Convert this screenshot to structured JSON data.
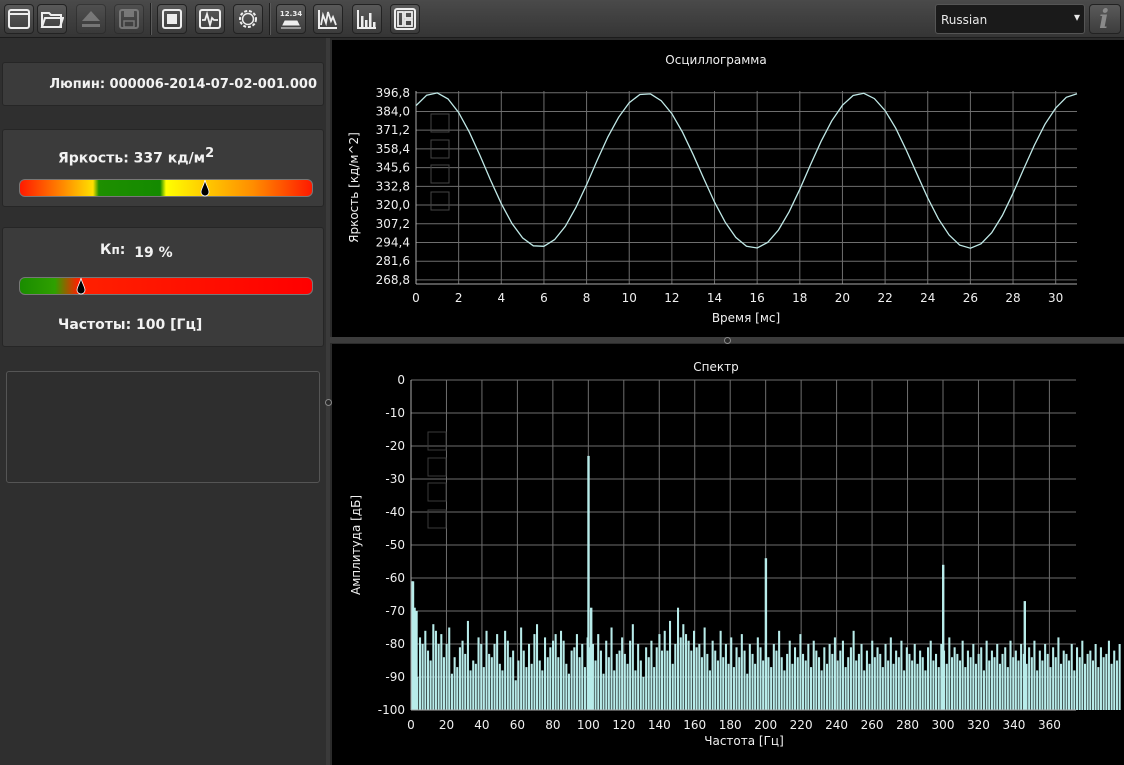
{
  "toolbar": {
    "buttons": [
      "window-icon",
      "open-folder-icon",
      "eject-icon",
      "save-icon",
      "stop-icon",
      "waveform-icon",
      "gear-icon",
      "counter-icon",
      "oscillogram-icon",
      "spectrum-icon",
      "layout-icon"
    ],
    "counter_label": "12.34",
    "language": "Russian"
  },
  "left": {
    "file_label": "Люпин: 000006-2014-07-02-001.000",
    "brightness_label": "Яркость: 337 кд/м",
    "brightness_sup": "2",
    "kp_label_main": "К",
    "kp_label_sub": "п",
    "kp_label_colon": ":",
    "kp_value": "19 %",
    "freq_label": "Частоты: 100 [Гц]",
    "brightness_gauge_fraction": 0.63,
    "kp_gauge_fraction": 0.19
  },
  "colors": {
    "trace": "#bfe8e6",
    "bar": "#b8ecea",
    "grid": "#6e6e6e",
    "axis_text": "#f0f0f0"
  },
  "chart_data": [
    {
      "type": "line",
      "title": "Осциллограмма",
      "xlabel": "Время [мс]",
      "ylabel": "Яркость [кд/м^2]",
      "xlim": [
        0,
        31
      ],
      "ylim": [
        266,
        398
      ],
      "xticks": [
        0,
        2,
        4,
        6,
        8,
        10,
        12,
        14,
        16,
        18,
        20,
        22,
        24,
        26,
        28,
        30
      ],
      "yticks": [
        268.8,
        281.6,
        294.4,
        307.2,
        320.0,
        332.8,
        345.6,
        358.4,
        371.2,
        384.0,
        396.8
      ],
      "ytick_labels": [
        "268,8",
        "281,6",
        "294,4",
        "307,2",
        "320,0",
        "332,8",
        "345,6",
        "358,4",
        "371,2",
        "384,0",
        "396,8"
      ],
      "grid": true,
      "x": [
        0,
        0.5,
        1,
        1.5,
        2,
        2.5,
        3,
        3.5,
        4,
        4.5,
        5,
        5.5,
        6,
        6.5,
        7,
        7.5,
        8,
        8.5,
        9,
        9.5,
        10,
        10.5,
        11,
        11.5,
        12,
        12.5,
        13,
        13.5,
        14,
        14.5,
        15,
        15.5,
        16,
        16.5,
        17,
        17.5,
        18,
        18.5,
        19,
        19.5,
        20,
        20.5,
        21,
        21.5,
        22,
        22.5,
        23,
        23.5,
        24,
        24.5,
        25,
        25.5,
        26,
        26.5,
        27,
        27.5,
        28,
        28.5,
        29,
        29.5,
        30,
        30.5,
        31
      ],
      "y": [
        388.0,
        395.1,
        396.7,
        392.6,
        383.3,
        369.9,
        353.9,
        337.0,
        320.9,
        307.4,
        297.5,
        292.1,
        291.8,
        296.4,
        305.4,
        318.3,
        333.9,
        350.6,
        366.6,
        380.0,
        390.0,
        395.6,
        396.0,
        391.4,
        382.5,
        369.8,
        354.4,
        337.9,
        322.0,
        308.3,
        297.9,
        291.8,
        290.6,
        294.5,
        302.9,
        315.4,
        330.8,
        347.5,
        363.6,
        377.6,
        388.3,
        394.9,
        396.4,
        392.8,
        384.6,
        372.5,
        357.4,
        341.0,
        324.9,
        310.6,
        299.5,
        292.6,
        290.5,
        293.5,
        301.1,
        312.9,
        328.0,
        344.7,
        361.0,
        375.3,
        386.4,
        393.7,
        396.1
      ]
    },
    {
      "type": "bar",
      "title": "Спектр",
      "xlabel": "Частота [Гц]",
      "ylabel": "Амплитуда [дБ]",
      "xlim": [
        0,
        375
      ],
      "ylim": [
        -100,
        0
      ],
      "xticks": [
        0,
        20,
        40,
        60,
        80,
        100,
        120,
        140,
        160,
        180,
        200,
        220,
        240,
        260,
        280,
        300,
        320,
        340,
        360
      ],
      "yticks": [
        -100,
        -90,
        -80,
        -70,
        -60,
        -50,
        -40,
        -30,
        -20,
        -10,
        0
      ],
      "grid": true,
      "bin_width_hz": 1.5,
      "values": [
        -61,
        -69,
        -90,
        -78,
        -80,
        -76,
        -82,
        -85,
        -74,
        -76,
        -80,
        -77,
        -84,
        -80,
        -75,
        -89,
        -84,
        -87,
        -81,
        -79,
        -83,
        -73,
        -88,
        -85,
        -86,
        -78,
        -80,
        -87,
        -76,
        -83,
        -84,
        -80,
        -77,
        -86,
        -88,
        -76,
        -79,
        -84,
        -82,
        -91,
        -85,
        -75,
        -82,
        -87,
        -80,
        -86,
        -77,
        -74,
        -85,
        -88,
        -78,
        -84,
        -81,
        -79,
        -77,
        -84,
        -76,
        -79,
        -86,
        -89,
        -82,
        -81,
        -77,
        -84,
        -80,
        -87,
        -78,
        -81,
        -80,
        -85,
        -77,
        -82,
        -89,
        -79,
        -84,
        -75,
        -88,
        -83,
        -82,
        -78,
        -83,
        -86,
        -79,
        -74,
        -88,
        -80,
        -85,
        -90,
        -81,
        -84,
        -79,
        -87,
        -81,
        -77,
        -82,
        -76,
        -82,
        -73,
        -86,
        -80,
        -69,
        -78,
        -74,
        -77,
        -79,
        -82,
        -76,
        -81,
        -80,
        -84,
        -75,
        -83,
        -88,
        -79,
        -82,
        -85,
        -76,
        -84,
        -80,
        -86,
        -78,
        -87,
        -81,
        -84,
        -77,
        -82,
        -89,
        -80,
        -83,
        -86,
        -78,
        -81,
        -85,
        -79,
        -84,
        -87,
        -80,
        -82,
        -76,
        -84,
        -88,
        -83,
        -79,
        -86,
        -81,
        -84,
        -77,
        -83,
        -85,
        -80,
        -87,
        -79,
        -82,
        -84,
        -88,
        -81,
        -86,
        -80,
        -83,
        -78,
        -85,
        -82,
        -79,
        -87,
        -84,
        -81,
        -76,
        -85,
        -83,
        -80,
        -88,
        -82,
        -86,
        -79,
        -84,
        -81,
        -83,
        -87,
        -80,
        -85,
        -78,
        -86,
        -82,
        -84,
        -79,
        -88,
        -81,
        -83,
        -85,
        -80,
        -86,
        -82,
        -84,
        -88,
        -81,
        -79,
        -85,
        -83,
        -87,
        -80,
        -82,
        -86,
        -78,
        -84,
        -81,
        -83,
        -85,
        -79,
        -87,
        -82,
        -84,
        -80,
        -86,
        -83,
        -81,
        -88,
        -79,
        -85,
        -82,
        -84,
        -80,
        -86,
        -83,
        -81,
        -87,
        -79,
        -84,
        -82,
        -85,
        -80,
        -83,
        -86,
        -81,
        -84,
        -79,
        -88,
        -82,
        -85,
        -80,
        -83,
        -87,
        -81,
        -84,
        -78,
        -86,
        -82,
        -83,
        -85,
        -80,
        -88,
        -81,
        -84,
        -79,
        -86,
        -83,
        -82,
        -85,
        -80,
        -87,
        -81,
        -84,
        -83,
        -79,
        -86,
        -82,
        -85,
        -80
      ],
      "peaks": [
        {
          "x": 1,
          "y": -61
        },
        {
          "x": 3,
          "y": -70
        },
        {
          "x": 100,
          "y": -23
        },
        {
          "x": 101.5,
          "y": -69
        },
        {
          "x": 200,
          "y": -54
        },
        {
          "x": 300,
          "y": -56
        },
        {
          "x": 346,
          "y": -67
        }
      ]
    }
  ]
}
